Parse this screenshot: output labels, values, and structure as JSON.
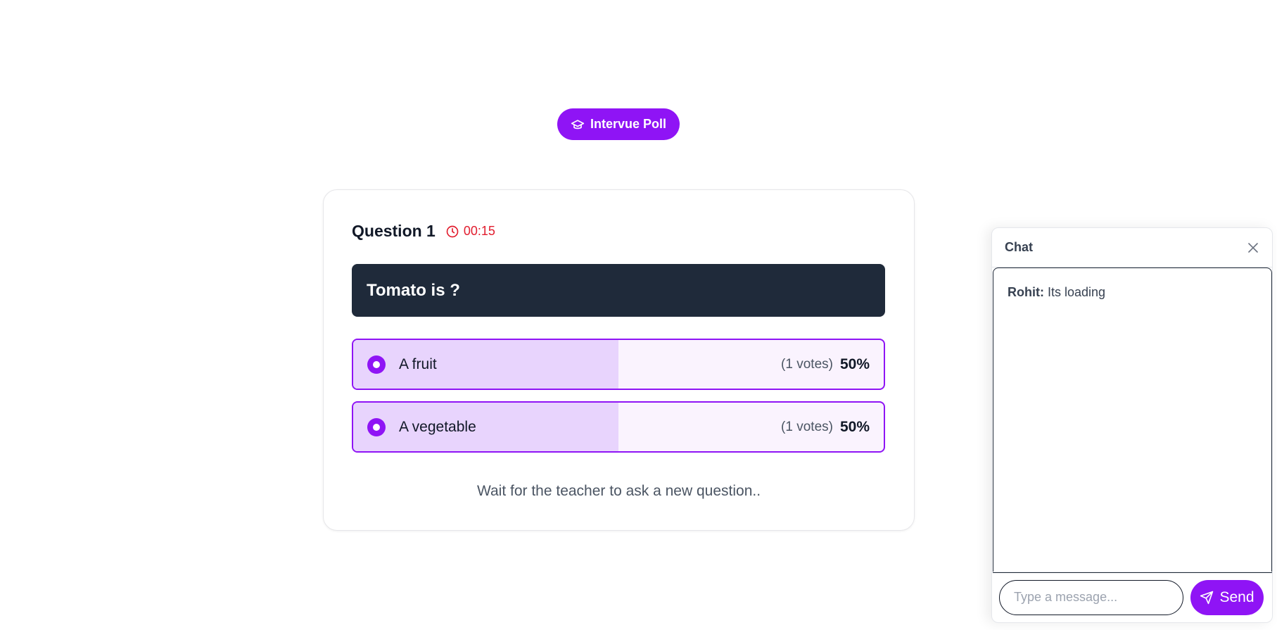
{
  "brand": {
    "label": "Intervue Poll",
    "icon": "graduation-cap-icon"
  },
  "poll": {
    "question_number": "Question 1",
    "timer": "00:15",
    "question_text": "Tomato is ?",
    "options": [
      {
        "label": "A fruit",
        "votes": "(1 votes)",
        "percent": "50%",
        "share": 0.5
      },
      {
        "label": "A vegetable",
        "votes": "(1 votes)",
        "percent": "50%",
        "share": 0.5
      }
    ],
    "wait_message": "Wait for the teacher to ask a new question.."
  },
  "chat": {
    "title": "Chat",
    "messages": [
      {
        "author": "Rohit:",
        "text": "Its loading"
      }
    ],
    "input_placeholder": "Type a message...",
    "send_label": "Send"
  },
  "colors": {
    "accent": "#8f14f5",
    "question_bg": "#1f2a3a",
    "timer": "#e11d2e",
    "option_fill": "#e8d4fd"
  }
}
